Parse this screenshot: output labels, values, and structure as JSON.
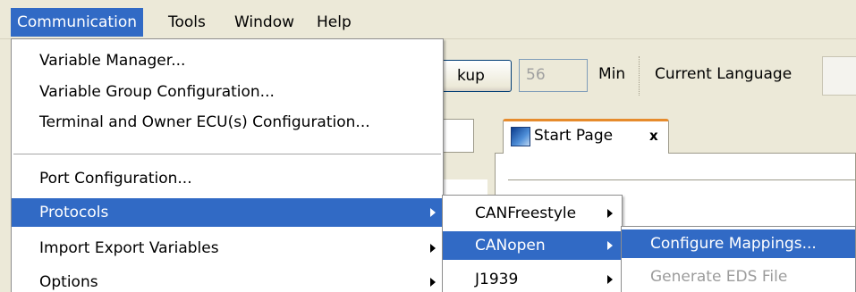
{
  "menubar": {
    "items": [
      {
        "label": "Communication"
      },
      {
        "label": "Tools"
      },
      {
        "label": "Window"
      },
      {
        "label": "Help"
      }
    ]
  },
  "toolbar": {
    "backup_label": "kup",
    "number_value": "56",
    "unit_label": "Min",
    "language_label": "Current Language"
  },
  "document": {
    "tab_label": "Start Page",
    "tab_close": "x"
  },
  "communication_menu": {
    "items": [
      {
        "label": "Variable Manager..."
      },
      {
        "label": "Variable Group Configuration..."
      },
      {
        "label": "Terminal and Owner ECU(s) Configuration..."
      },
      {
        "label": "Port Configuration..."
      },
      {
        "label": "Protocols"
      },
      {
        "label": "Import Export Variables"
      },
      {
        "label": "Options"
      }
    ]
  },
  "protocols_menu": {
    "items": [
      {
        "label": "CANFreestyle"
      },
      {
        "label": "CANopen"
      },
      {
        "label": "J1939"
      }
    ]
  },
  "canopen_menu": {
    "items": [
      {
        "label": "Configure Mappings..."
      },
      {
        "label": "Generate EDS File"
      }
    ]
  },
  "colors": {
    "selection": "#316ac5",
    "menubar_bg": "#ece9d8",
    "tab_accent": "#e68b2c",
    "disabled_text": "#9c9c9c"
  },
  "icons": [
    "start-page-icon",
    "submenu-arrow-icon",
    "tab-close-icon"
  ]
}
